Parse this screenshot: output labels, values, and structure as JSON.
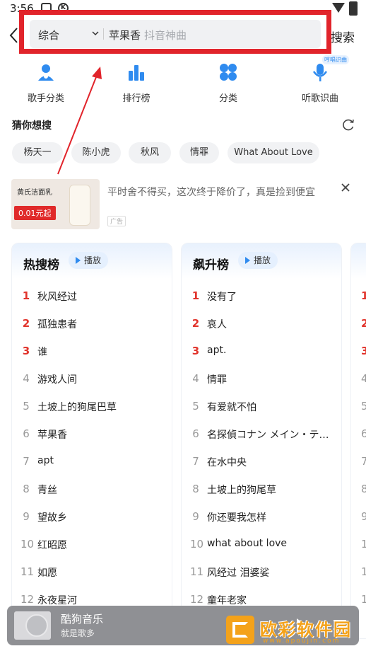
{
  "status_bar": {
    "time": "3:56",
    "icon_a": "A",
    "icon_k": "K",
    "battery": ""
  },
  "search": {
    "type_label": "综合",
    "query": "苹果香",
    "placeholder": "抖音神曲",
    "submit_label": "搜索"
  },
  "quick_nav": [
    {
      "label": "歌手分类",
      "icon": "singer-icon"
    },
    {
      "label": "排行榜",
      "icon": "bar-chart-icon"
    },
    {
      "label": "分类",
      "icon": "grid-icon"
    },
    {
      "label": "听歌识曲",
      "icon": "mic-icon"
    }
  ],
  "quick_nav_badge": "哼唱识曲",
  "guess": {
    "title": "猜你想搜",
    "chips": [
      "杨天一",
      "陈小虎",
      "秋风",
      "情罪",
      "What About Love"
    ]
  },
  "ad": {
    "text": "平时舍不得买，这次终于降价了，真是捡到便宜",
    "tag": "广告",
    "image_brand": "黄氏洁面乳",
    "image_price": "0.01元起"
  },
  "charts": [
    {
      "title": "热搜榜",
      "play_label": "播放",
      "items": [
        "秋风经过",
        "孤独患者",
        "谁",
        "游戏人间",
        "土坡上的狗尾巴草",
        "苹果香",
        "apt",
        "青丝",
        "望故乡",
        "红昭愿",
        "如愿",
        "永夜星河"
      ]
    },
    {
      "title": "飙升榜",
      "play_label": "播放",
      "items": [
        "没有了",
        "哀人",
        "apt.",
        "情罪",
        "有爱就不怕",
        "名探偵コナン メイン・テ…",
        "在水中央",
        "土坡上的狗尾草",
        "你还要我怎样",
        "what about love",
        "风经过 泪婆娑",
        "童年老家"
      ]
    }
  ],
  "player": {
    "title": "酷狗音乐",
    "subtitle": "就是歌多"
  },
  "watermark": {
    "text": "欧彩软件园",
    "url": "www.apoujin.com"
  },
  "colors": {
    "accent": "#2f8bef",
    "highlight_box": "#e1242b",
    "rank_top": "#e1342c",
    "watermark": "#f4a21a"
  }
}
